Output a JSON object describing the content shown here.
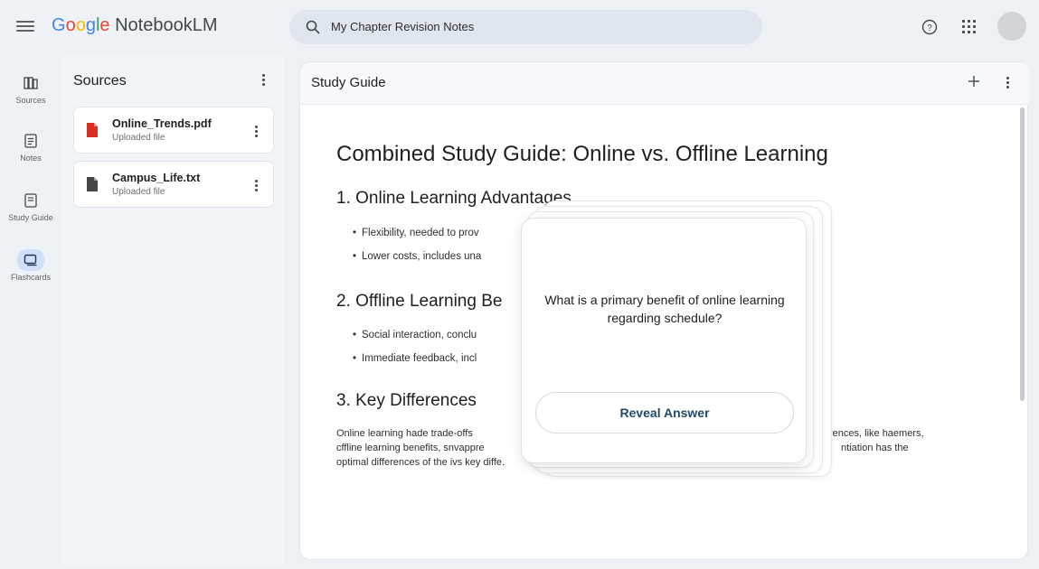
{
  "app": {
    "brand_google": [
      "G",
      "o",
      "o",
      "g",
      "l",
      "e"
    ],
    "brand_product": "NotebookLM"
  },
  "search": {
    "value": "My Chapter Revision Notes"
  },
  "rail": {
    "items": [
      {
        "label": "Sources",
        "icon": "library-icon"
      },
      {
        "label": "Notes",
        "icon": "note-icon"
      },
      {
        "label": "Study Guide",
        "icon": "study-guide-icon"
      },
      {
        "label": "Flashcards",
        "icon": "flashcards-icon",
        "active": true
      }
    ]
  },
  "sources": {
    "title": "Sources",
    "files": [
      {
        "name": "Online_Trends.pdf",
        "sub": "Uploaded file",
        "icon": "pdf-file-icon",
        "color": "#d93025"
      },
      {
        "name": "Campus_Life.txt",
        "sub": "Uploaded file",
        "icon": "text-file-icon",
        "color": "#444746"
      }
    ]
  },
  "main": {
    "title": "Study Guide",
    "doc_title": "Combined Study Guide: Online vs. Offline Learning",
    "sections": [
      {
        "heading": "1. Online Learning Advantages",
        "bullets": [
          "Flexibility, needed to prov",
          "Lower costs, includes una"
        ]
      },
      {
        "heading": "2. Offline Learning Be",
        "bullets": [
          "Social interaction, conclu",
          "Immediate feedback, incl"
        ]
      },
      {
        "heading": "3. Key Differences",
        "paragraph": [
          "Online learning hade trade-offs",
          "cffline learning benefits, snvappre",
          "optimal differences of the ivs key diffe."
        ],
        "paragraph_right": [
          "rences, like haemers,",
          "ntiation has the"
        ]
      }
    ]
  },
  "flashcard": {
    "question": "What is a primary benefit of online learning regarding schedule?",
    "button_label": "Reveal Answer"
  },
  "colors": {
    "accent": "#23496b",
    "rail_active": "#cfe0f7",
    "background": "#eef2f7"
  }
}
